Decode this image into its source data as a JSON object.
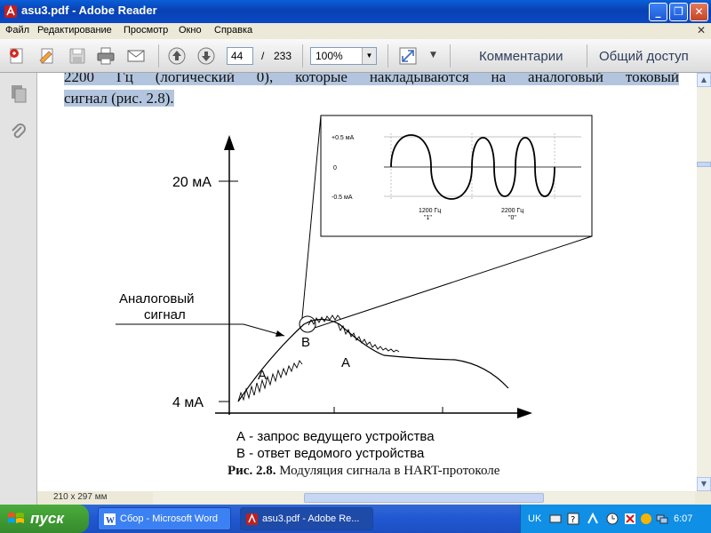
{
  "window": {
    "title": "asu3.pdf - Adobe Reader"
  },
  "menu": [
    "Файл",
    "Редактирование",
    "Просмотр",
    "Окно",
    "Справка"
  ],
  "toolbar": {
    "page_current": "44",
    "page_sep": "/",
    "page_total": "233",
    "zoom": "100%",
    "comments_label": "Комментарии",
    "share_label": "Общий доступ"
  },
  "document": {
    "line1_number": "2200",
    "line1_rest": "Гц (логический 0), которые накладываются на аналоговый токовый",
    "line2": "сигнал (рис. 2.8).",
    "figure": {
      "y_label_top": "20 мА",
      "y_label_bottom": "4 мА",
      "analog_label_1": "Аналоговый",
      "analog_label_2": "сигнал",
      "point_a1": "А",
      "point_b": "В",
      "point_a2": "А",
      "legend_a": "А - запрос ведущего устройства",
      "legend_b": "В - ответ ведомого устройства",
      "inset_plus": "+0.5 мА",
      "inset_zero": "0",
      "inset_minus": "-0.5 мА",
      "inset_f1": "1200 Гц",
      "inset_f1_bit": "\"1\"",
      "inset_f2": "2200 Гц",
      "inset_f2_bit": "\"0\""
    },
    "caption_bold": "Рис. 2.8.",
    "caption_text": " Модуляция сигнала в HART-протоколе"
  },
  "status": {
    "page_size": "210 x 297 мм"
  },
  "taskbar": {
    "start": "пуск",
    "tasks": [
      {
        "label": "Сбор - Microsoft Word"
      },
      {
        "label": "asu3.pdf - Adobe Re..."
      }
    ],
    "lang": "UK",
    "clock": "6:07"
  },
  "colors": {
    "accent": "#0841b3",
    "highlight": "#b3c5de",
    "start_green": "#358a2c"
  }
}
